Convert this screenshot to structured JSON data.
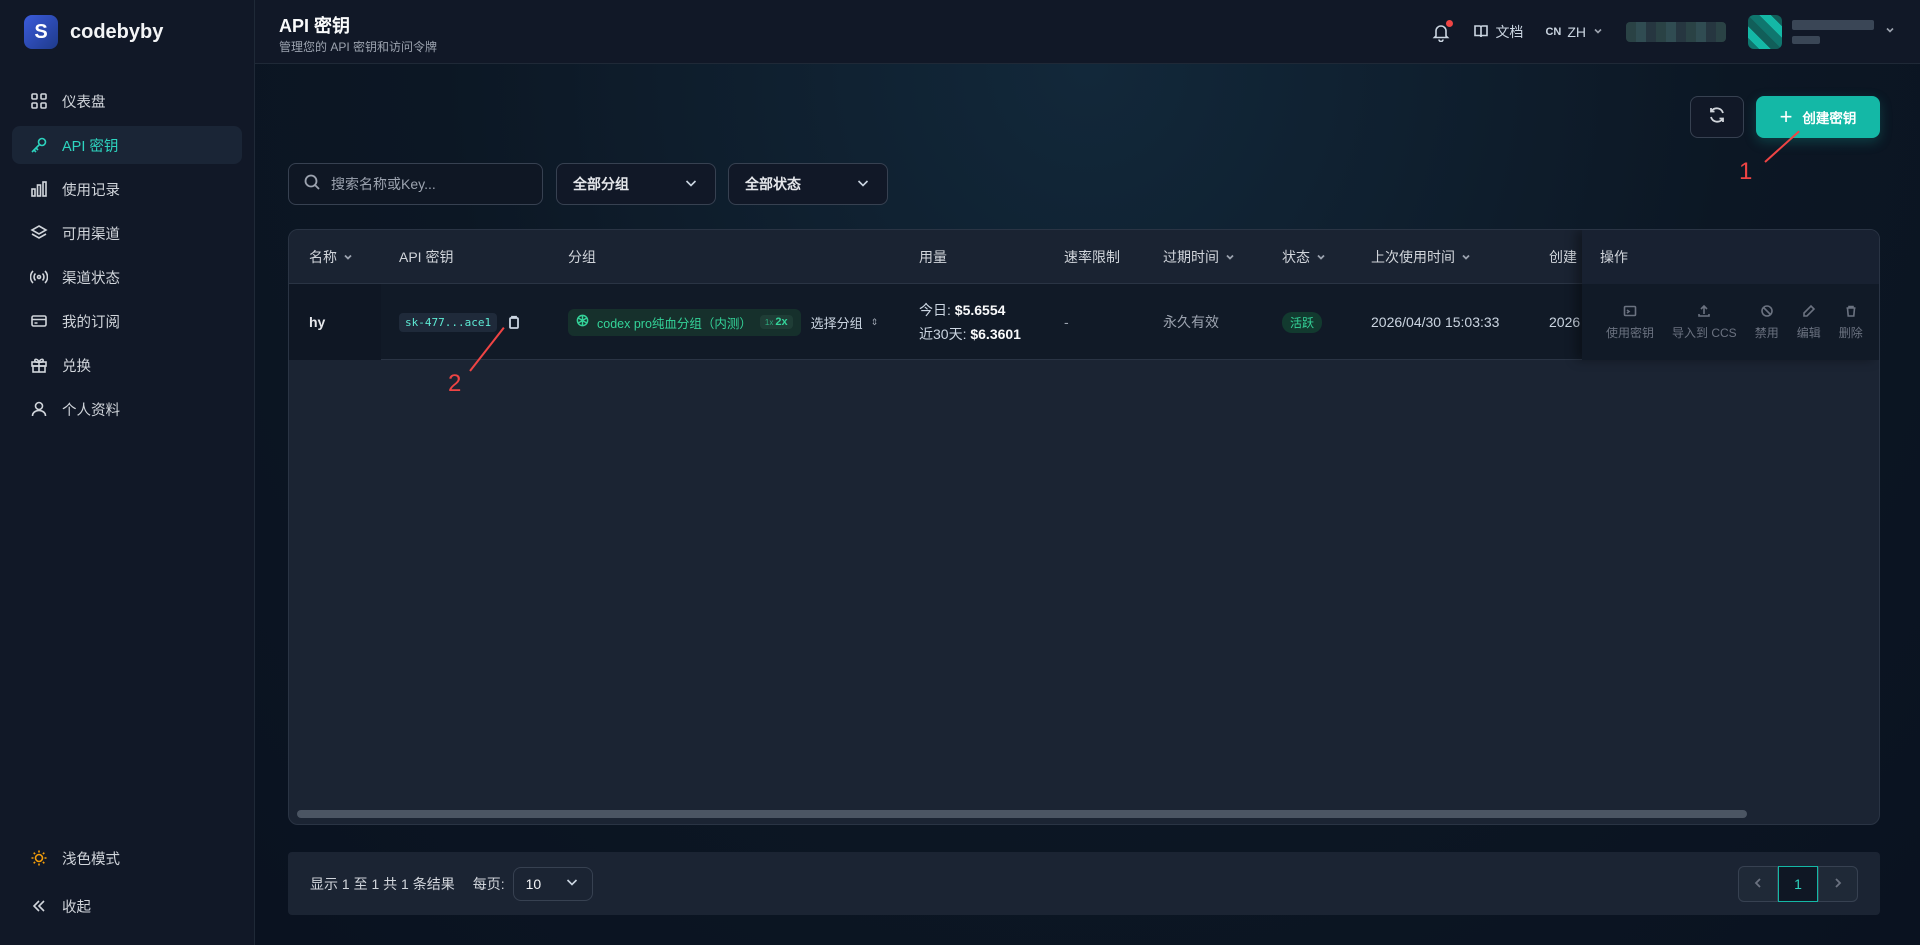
{
  "brand": {
    "name": "codebyby"
  },
  "sidebar": {
    "items": [
      {
        "label": "仪表盘",
        "icon": "dashboard-icon"
      },
      {
        "label": "API 密钥",
        "icon": "key-icon",
        "active": true
      },
      {
        "label": "使用记录",
        "icon": "bar-chart-icon"
      },
      {
        "label": "可用渠道",
        "icon": "layers-icon"
      },
      {
        "label": "渠道状态",
        "icon": "broadcast-icon"
      },
      {
        "label": "我的订阅",
        "icon": "credit-card-icon"
      },
      {
        "label": "兑换",
        "icon": "gift-icon"
      },
      {
        "label": "个人资料",
        "icon": "user-icon"
      }
    ],
    "theme_toggle": "浅色模式",
    "collapse": "收起"
  },
  "header": {
    "title": "API 密钥",
    "subtitle": "管理您的 API 密钥和访问令牌",
    "docs": "文档",
    "lang_code": "CN",
    "lang": "ZH"
  },
  "toolbar": {
    "create_label": "创建密钥",
    "search_placeholder": "搜索名称或Key...",
    "group_filter": "全部分组",
    "status_filter": "全部状态"
  },
  "annotations": {
    "one": "1",
    "two": "2"
  },
  "table": {
    "columns": {
      "name": "名称",
      "key": "API 密钥",
      "group": "分组",
      "usage": "用量",
      "rate": "速率限制",
      "expire": "过期时间",
      "status": "状态",
      "last_used": "上次使用时间",
      "created": "创建",
      "actions": "操作"
    },
    "rows": [
      {
        "name": "hy",
        "key": "sk-477...ace1",
        "group": "codex pro纯血分组（内测）",
        "multiplier_prefix": "1x",
        "multiplier": "2x",
        "select_group": "选择分组",
        "today_label": "今日:",
        "today_value": "$5.6554",
        "month_label": "近30天:",
        "month_value": "$6.3601",
        "rate": "-",
        "expire": "永久有效",
        "status": "活跃",
        "last_used": "2026/04/30 15:03:33",
        "created": "2026"
      }
    ],
    "actions": [
      "使用密钥",
      "导入到 CCS",
      "禁用",
      "编辑",
      "删除"
    ]
  },
  "pagination": {
    "summary": "显示 1 至 1 共 1 条结果",
    "per_page_label": "每页:",
    "per_page": "10",
    "current_page": "1"
  }
}
